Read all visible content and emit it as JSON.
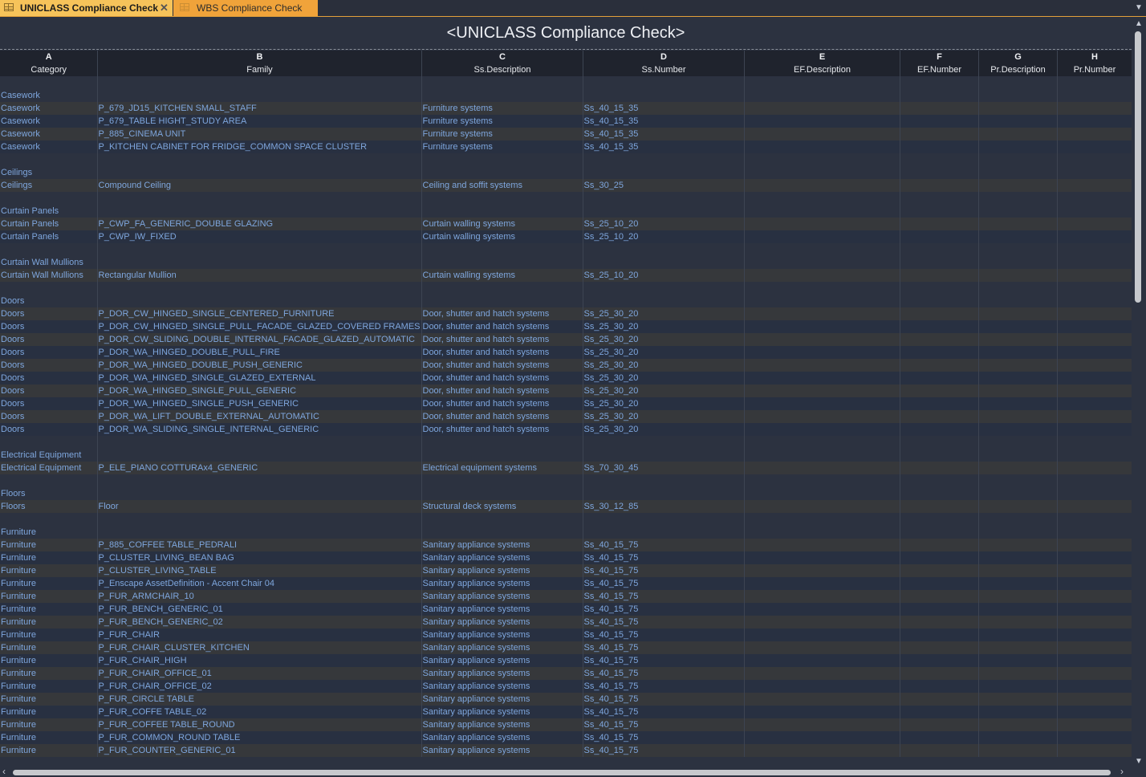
{
  "tabs": [
    {
      "label": "UNICLASS Compliance Check",
      "active": true
    },
    {
      "label": "WBS Compliance Check",
      "active": false
    }
  ],
  "schedule": {
    "title": "<UNICLASS Compliance Check>",
    "column_letters": [
      "A",
      "B",
      "C",
      "D",
      "E",
      "F",
      "G",
      "H"
    ],
    "column_headers": [
      "Category",
      "Family",
      "Ss.Description",
      "Ss.Number",
      "EF.Description",
      "EF.Number",
      "Pr.Description",
      "Pr.Number"
    ],
    "groups": [
      {
        "name": "Casework",
        "rows": [
          [
            "Casework",
            "P_679_JD15_KITCHEN SMALL_STAFF",
            "Furniture systems",
            "Ss_40_15_35"
          ],
          [
            "Casework",
            "P_679_TABLE HIGHT_STUDY AREA",
            "Furniture systems",
            "Ss_40_15_35"
          ],
          [
            "Casework",
            "P_885_CINEMA UNIT",
            "Furniture systems",
            "Ss_40_15_35"
          ],
          [
            "Casework",
            "P_KITCHEN CABINET FOR FRIDGE_COMMON SPACE CLUSTER",
            "Furniture systems",
            "Ss_40_15_35"
          ]
        ]
      },
      {
        "name": "Ceilings",
        "rows": [
          [
            "Ceilings",
            "Compound Ceiling",
            "Ceiling and soffit systems",
            "Ss_30_25"
          ]
        ]
      },
      {
        "name": "Curtain Panels",
        "rows": [
          [
            "Curtain Panels",
            "P_CWP_FA_GENERIC_DOUBLE GLAZING",
            "Curtain walling systems",
            "Ss_25_10_20"
          ],
          [
            "Curtain Panels",
            "P_CWP_IW_FIXED",
            "Curtain walling systems",
            "Ss_25_10_20"
          ]
        ]
      },
      {
        "name": "Curtain Wall Mullions",
        "rows": [
          [
            "Curtain Wall Mullions",
            "Rectangular Mullion",
            "Curtain walling systems",
            "Ss_25_10_20"
          ]
        ]
      },
      {
        "name": "Doors",
        "rows": [
          [
            "Doors",
            "P_DOR_CW_HINGED_SINGLE_CENTERED_FURNITURE",
            "Door, shutter and hatch systems",
            "Ss_25_30_20"
          ],
          [
            "Doors",
            "P_DOR_CW_HINGED_SINGLE_PULL_FACADE_GLAZED_COVERED FRAMES",
            "Door, shutter and hatch systems",
            "Ss_25_30_20"
          ],
          [
            "Doors",
            "P_DOR_CW_SLIDING_DOUBLE_INTERNAL_FACADE_GLAZED_AUTOMATIC",
            "Door, shutter and hatch systems",
            "Ss_25_30_20"
          ],
          [
            "Doors",
            "P_DOR_WA_HINGED_DOUBLE_PULL_FIRE",
            "Door, shutter and hatch systems",
            "Ss_25_30_20"
          ],
          [
            "Doors",
            "P_DOR_WA_HINGED_DOUBLE_PUSH_GENERIC",
            "Door, shutter and hatch systems",
            "Ss_25_30_20"
          ],
          [
            "Doors",
            "P_DOR_WA_HINGED_SINGLE_GLAZED_EXTERNAL",
            "Door, shutter and hatch systems",
            "Ss_25_30_20"
          ],
          [
            "Doors",
            "P_DOR_WA_HINGED_SINGLE_PULL_GENERIC",
            "Door, shutter and hatch systems",
            "Ss_25_30_20"
          ],
          [
            "Doors",
            "P_DOR_WA_HINGED_SINGLE_PUSH_GENERIC",
            "Door, shutter and hatch systems",
            "Ss_25_30_20"
          ],
          [
            "Doors",
            "P_DOR_WA_LIFT_DOUBLE_EXTERNAL_AUTOMATIC",
            "Door, shutter and hatch systems",
            "Ss_25_30_20"
          ],
          [
            "Doors",
            "P_DOR_WA_SLIDING_SINGLE_INTERNAL_GENERIC",
            "Door, shutter and hatch systems",
            "Ss_25_30_20"
          ]
        ]
      },
      {
        "name": "Electrical Equipment",
        "rows": [
          [
            "Electrical Equipment",
            "P_ELE_PIANO COTTURAx4_GENERIC",
            "Electrical equipment systems",
            "Ss_70_30_45"
          ]
        ]
      },
      {
        "name": "Floors",
        "rows": [
          [
            "Floors",
            "Floor",
            "Structural deck systems",
            "Ss_30_12_85"
          ]
        ]
      },
      {
        "name": "Furniture",
        "rows": [
          [
            "Furniture",
            "P_885_COFFEE TABLE_PEDRALI",
            "Sanitary appliance systems",
            "Ss_40_15_75"
          ],
          [
            "Furniture",
            "P_CLUSTER_LIVING_BEAN BAG",
            "Sanitary appliance systems",
            "Ss_40_15_75"
          ],
          [
            "Furniture",
            "P_CLUSTER_LIVING_TABLE",
            "Sanitary appliance systems",
            "Ss_40_15_75"
          ],
          [
            "Furniture",
            "P_Enscape AssetDefinition - Accent Chair 04",
            "Sanitary appliance systems",
            "Ss_40_15_75"
          ],
          [
            "Furniture",
            "P_FUR_ARMCHAIR_10",
            "Sanitary appliance systems",
            "Ss_40_15_75"
          ],
          [
            "Furniture",
            "P_FUR_BENCH_GENERIC_01",
            "Sanitary appliance systems",
            "Ss_40_15_75"
          ],
          [
            "Furniture",
            "P_FUR_BENCH_GENERIC_02",
            "Sanitary appliance systems",
            "Ss_40_15_75"
          ],
          [
            "Furniture",
            "P_FUR_CHAIR",
            "Sanitary appliance systems",
            "Ss_40_15_75"
          ],
          [
            "Furniture",
            "P_FUR_CHAIR_CLUSTER_KITCHEN",
            "Sanitary appliance systems",
            "Ss_40_15_75"
          ],
          [
            "Furniture",
            "P_FUR_CHAIR_HIGH",
            "Sanitary appliance systems",
            "Ss_40_15_75"
          ],
          [
            "Furniture",
            "P_FUR_CHAIR_OFFICE_01",
            "Sanitary appliance systems",
            "Ss_40_15_75"
          ],
          [
            "Furniture",
            "P_FUR_CHAIR_OFFICE_02",
            "Sanitary appliance systems",
            "Ss_40_15_75"
          ],
          [
            "Furniture",
            "P_FUR_CIRCLE TABLE",
            "Sanitary appliance systems",
            "Ss_40_15_75"
          ],
          [
            "Furniture",
            "P_FUR_COFFE TABLE_02",
            "Sanitary appliance systems",
            "Ss_40_15_75"
          ],
          [
            "Furniture",
            "P_FUR_COFFEE TABLE_ROUND",
            "Sanitary appliance systems",
            "Ss_40_15_75"
          ],
          [
            "Furniture",
            "P_FUR_COMMON_ROUND TABLE",
            "Sanitary appliance systems",
            "Ss_40_15_75"
          ],
          [
            "Furniture",
            "P_FUR_COUNTER_GENERIC_01",
            "Sanitary appliance systems",
            "Ss_40_15_75"
          ]
        ]
      }
    ]
  }
}
